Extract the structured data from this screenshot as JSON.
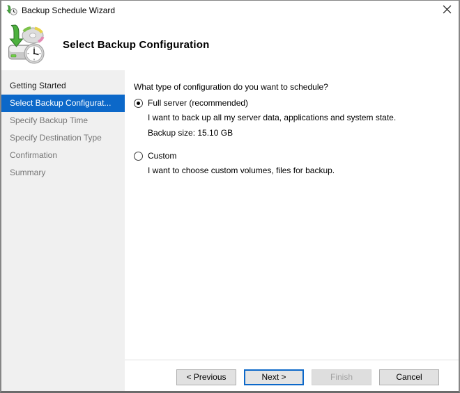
{
  "window": {
    "title": "Backup Schedule Wizard"
  },
  "icons": {
    "titlebar": "backup-arrow-clock-icon",
    "close": "close-icon (✕)",
    "header": "backup-drive-cd-clock-icon"
  },
  "header": {
    "title": "Select Backup Configuration"
  },
  "sidebar": {
    "items": [
      {
        "label": "Getting Started",
        "state": "completed"
      },
      {
        "label": "Select Backup Configurat...",
        "state": "current"
      },
      {
        "label": "Specify Backup Time",
        "state": "upcoming"
      },
      {
        "label": "Specify Destination Type",
        "state": "upcoming"
      },
      {
        "label": "Confirmation",
        "state": "upcoming"
      },
      {
        "label": "Summary",
        "state": "upcoming"
      }
    ]
  },
  "content": {
    "question": "What type of configuration do you want to schedule?",
    "options": [
      {
        "label": "Full server (recommended)",
        "selected": true,
        "description": "I want to back up all my server data, applications and system state.",
        "extra": "Backup size: 15.10 GB"
      },
      {
        "label": "Custom",
        "selected": false,
        "description": "I want to choose custom volumes, files for backup."
      }
    ]
  },
  "footer": {
    "buttons": [
      {
        "label": "< Previous",
        "state": "enabled"
      },
      {
        "label": "Next >",
        "state": "focused"
      },
      {
        "label": "Finish",
        "state": "disabled"
      },
      {
        "label": "Cancel",
        "state": "enabled"
      }
    ]
  },
  "colors": {
    "accent": "#0c68c9",
    "sidebar_bg": "#f0f0f0",
    "button_bg": "#e1e1e1",
    "button_border": "#adadad",
    "disabled_text": "#a2a2a2",
    "window_border": "#868686",
    "upcoming_step_text": "#767676"
  }
}
